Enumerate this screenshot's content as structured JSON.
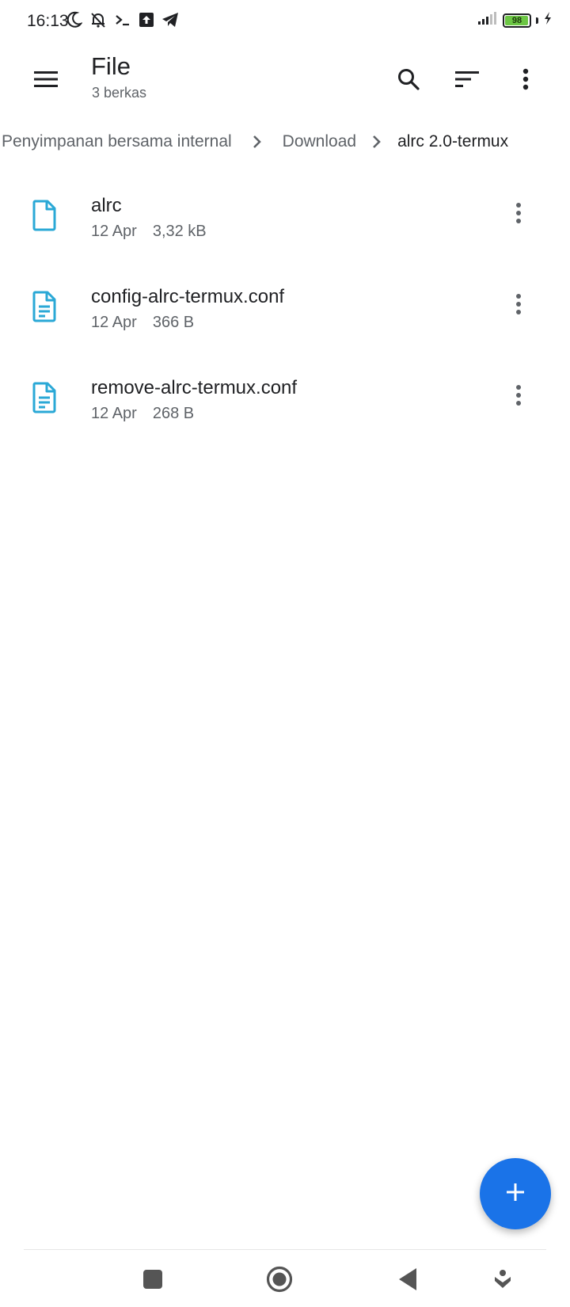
{
  "status_bar": {
    "time": "16:13",
    "battery_level": "98",
    "battery_fraction": 0.98,
    "icons_left": [
      "moon-icon",
      "bell-off-icon",
      "terminal-icon",
      "upload-icon",
      "telegram-icon"
    ],
    "icons_right": [
      "signal-icon",
      "battery-icon",
      "charging-icon"
    ]
  },
  "app_bar": {
    "title": "File",
    "subtitle": "3 berkas",
    "icons": [
      "menu-icon",
      "search-icon",
      "sort-icon",
      "more-vert-icon"
    ]
  },
  "breadcrumb": {
    "items": [
      "Penyimpanan bersama internal",
      "Download",
      "alrc 2.0-termux"
    ]
  },
  "files": [
    {
      "name": "alrc",
      "date": "12 Apr",
      "size": "3,32 kB",
      "icon": "file-icon"
    },
    {
      "name": "config-alrc-termux.conf",
      "date": "12 Apr",
      "size": "366 B",
      "icon": "text-file-icon"
    },
    {
      "name": "remove-alrc-termux.conf",
      "date": "12 Apr",
      "size": "268 B",
      "icon": "text-file-icon"
    }
  ],
  "fab": {
    "icon": "plus-icon"
  },
  "nav_bar": {
    "icons": [
      "recents-square-icon",
      "home-circle-icon",
      "back-triangle-icon",
      "gesture-down-icon"
    ]
  },
  "colors": {
    "accent": "#1a73e8",
    "file_icon": "#2aa8d6",
    "battery_fill": "#6cc644",
    "text_primary": "#202124",
    "text_secondary": "#5f6368"
  }
}
